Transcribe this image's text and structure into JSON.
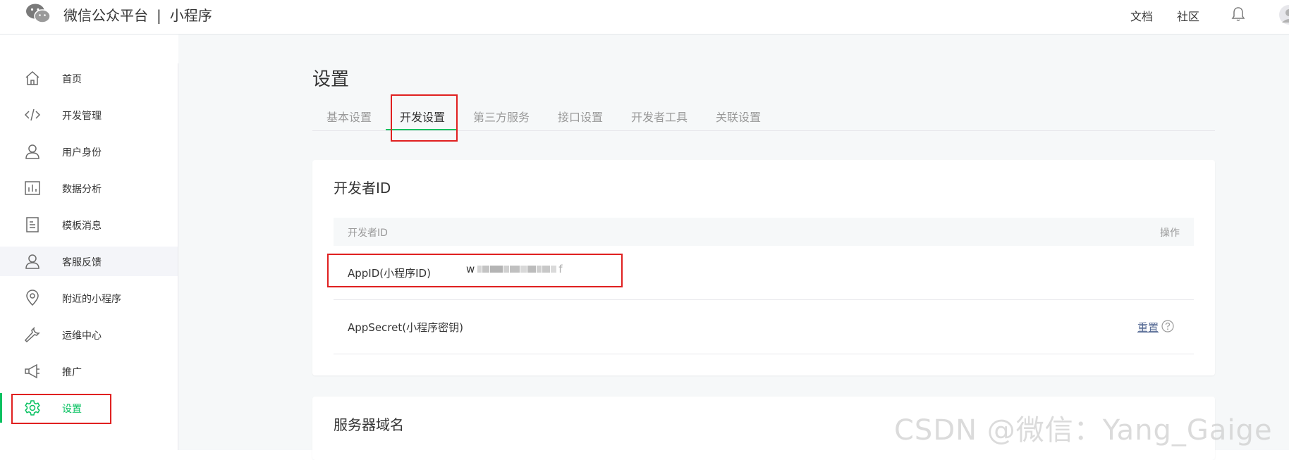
{
  "header": {
    "brand": "微信公众平台",
    "separator": "|",
    "product": "小程序",
    "links": [
      "文档",
      "社区"
    ]
  },
  "sidebar": {
    "items": [
      {
        "label": "首页",
        "icon": "home-icon"
      },
      {
        "label": "开发管理",
        "icon": "code-icon"
      },
      {
        "label": "用户身份",
        "icon": "user-icon"
      },
      {
        "label": "数据分析",
        "icon": "bar-chart-icon"
      },
      {
        "label": "模板消息",
        "icon": "document-icon"
      },
      {
        "label": "客服反馈",
        "icon": "user-icon"
      },
      {
        "label": "附近的小程序",
        "icon": "location-pin-icon"
      },
      {
        "label": "运维中心",
        "icon": "wrench-icon"
      },
      {
        "label": "推广",
        "icon": "megaphone-icon"
      },
      {
        "label": "设置",
        "icon": "gear-icon"
      }
    ],
    "active_index": 9,
    "hover_index": 5
  },
  "main": {
    "title": "设置",
    "tabs": [
      "基本设置",
      "开发设置",
      "第三方服务",
      "接口设置",
      "开发者工具",
      "关联设置"
    ],
    "active_tab": 1,
    "developer_card": {
      "title": "开发者ID",
      "columns": [
        "开发者ID",
        "操作"
      ],
      "rows": [
        {
          "label": "AppID(小程序ID)",
          "value_prefix": "w",
          "value_suffix": "f",
          "action": ""
        },
        {
          "label": "AppSecret(小程序密钥)",
          "value": "",
          "action": "重置"
        }
      ]
    },
    "server_card": {
      "title": "服务器域名"
    }
  },
  "watermark": "CSDN @微信：Yang_Gaige",
  "colors": {
    "accent": "#07c160",
    "link": "#576b95",
    "highlight": "#e02020",
    "page_bg": "#f6f8f9"
  }
}
